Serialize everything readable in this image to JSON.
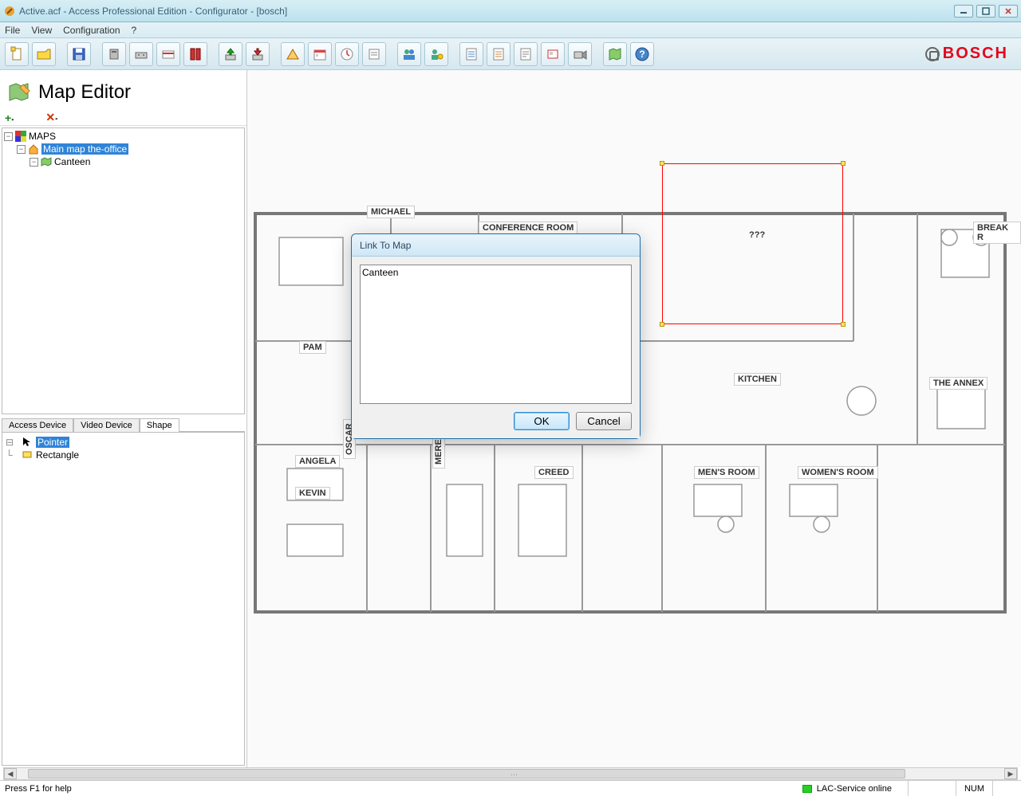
{
  "title": "Active.acf - Access Professional Edition - Configurator - [bosch]",
  "menu": {
    "file": "File",
    "view": "View",
    "config": "Configuration",
    "help": "?"
  },
  "brand": "BOSCH",
  "heading": "Map Editor",
  "tree": {
    "root": "MAPS",
    "items": [
      {
        "label": "Main map the-office",
        "selected": true
      },
      {
        "label": "Canteen",
        "selected": false
      }
    ]
  },
  "tabs": {
    "access": "Access Device",
    "video": "Video Device",
    "shape": "Shape"
  },
  "shapes": [
    {
      "label": "Pointer",
      "selected": true
    },
    {
      "label": "Rectangle",
      "selected": false
    }
  ],
  "rooms": {
    "michael": "MICHAEL",
    "conference": "CONFERENCE ROOM",
    "qqq": "???",
    "breakr": "BREAK R",
    "pam": "PAM",
    "kitchen": "KITCHEN",
    "annex": "THE ANNEX",
    "angela": "ANGELA",
    "kevin": "KEVIN",
    "oscar": "OSCAR",
    "meredith": "MEREDITH",
    "creed": "CREED",
    "mens": "MEN'S ROOM",
    "womens": "WOMEN'S ROOM"
  },
  "dialog": {
    "title": "Link To Map",
    "item": "Canteen",
    "ok": "OK",
    "cancel": "Cancel"
  },
  "status": {
    "help": "Press F1 for help",
    "service": "LAC-Service online",
    "num": "NUM"
  }
}
